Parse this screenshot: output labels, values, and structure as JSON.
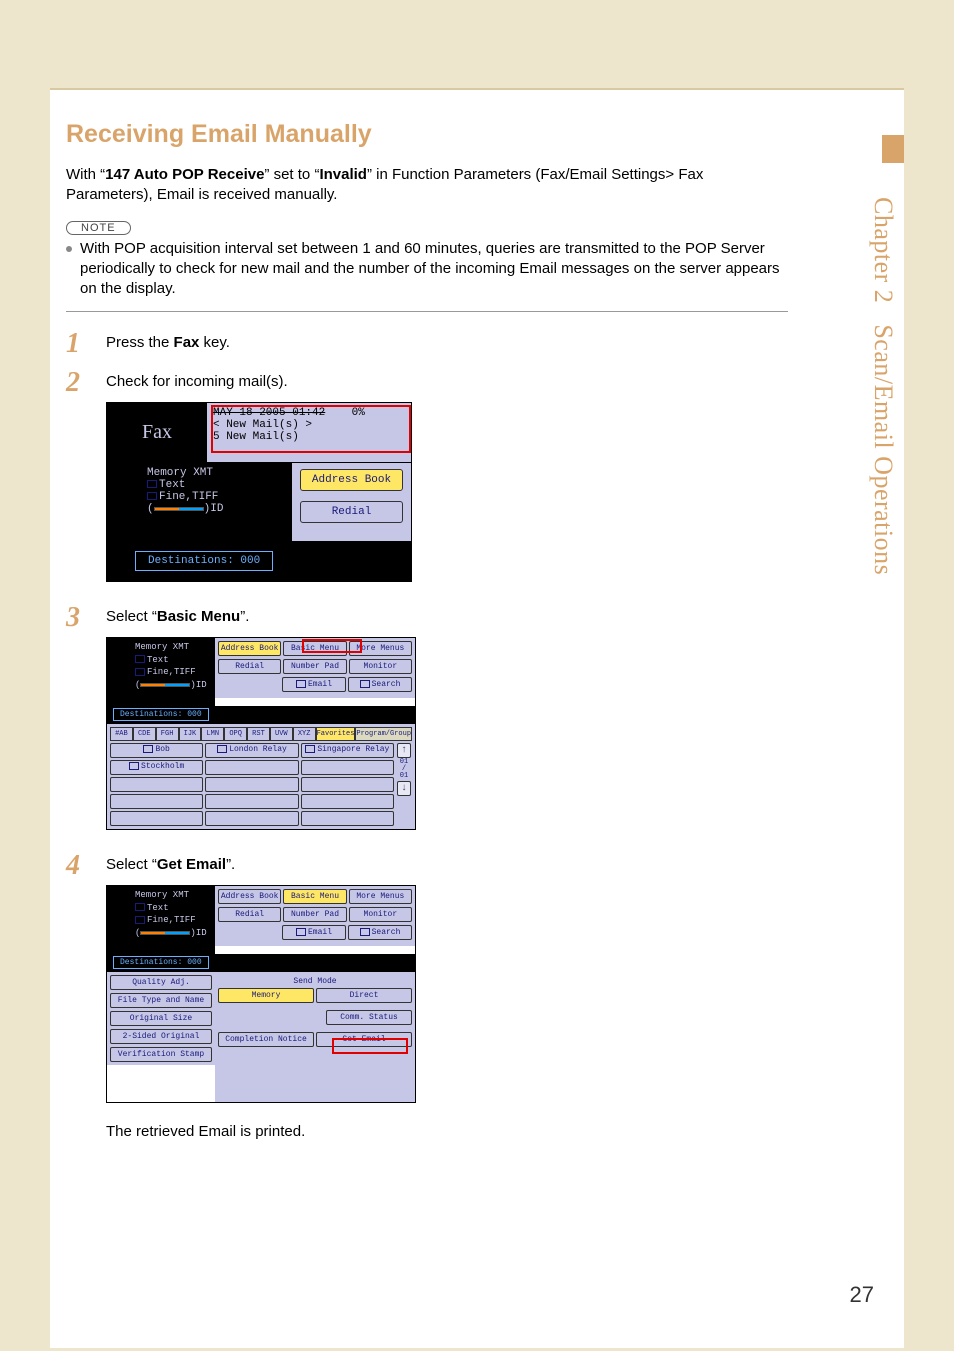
{
  "side_chapter": "Chapter 2",
  "side_section": "Scan/Email Operations",
  "heading": "Receiving Email Manually",
  "intro_pre": "With “",
  "intro_bold1": "147 Auto POP Receive",
  "intro_mid1": "” set to “",
  "intro_bold2": "Invalid",
  "intro_post": "” in Function Parameters (Fax/Email Settings> Fax Parameters), Email is received manually.",
  "note_label": "NOTE",
  "note_text": "With POP acquisition interval set between 1 and 60 minutes, queries are transmitted to the POP Server periodically to check for new mail and the number of the incoming Email messages on the server appears on the display.",
  "steps": {
    "s1_num": "1",
    "s1_pre": "Press the ",
    "s1_bold": "Fax",
    "s1_post": " key.",
    "s2_num": "2",
    "s2_text": "Check for incoming mail(s).",
    "s3_num": "3",
    "s3_pre": "Select “",
    "s3_bold": "Basic Menu",
    "s3_post": "”.",
    "s4_num": "4",
    "s4_pre": "Select “",
    "s4_bold": "Get Email",
    "s4_post": "”.",
    "s4_tail": "The retrieved Email is printed."
  },
  "fig1": {
    "fax": "Fax",
    "date": "MAY 18 2005  01:42",
    "pct": "0%",
    "newmail1": "< New Mail(s) >",
    "newmail2": "5 New Mail(s)",
    "memory_xmt": "Memory XMT",
    "text": "Text",
    "fine": "Fine,TIFF",
    "id": "ID",
    "addr": "Address Book",
    "redial": "Redial",
    "dest": "Destinations: 000"
  },
  "fig2": {
    "memory_xmt": "Memory XMT",
    "text": "Text",
    "fine": "Fine,TIFF",
    "id": "ID",
    "dest": "Destinations: 000",
    "top": {
      "addr": "Address Book",
      "basic": "Basic Menu",
      "more": "More Menus"
    },
    "row2": {
      "redial": "Redial",
      "numpad": "Number Pad",
      "monitor": "Monitor"
    },
    "row3": {
      "email": "Email",
      "search": "Search"
    },
    "tabs": [
      "#AB",
      "CDE",
      "FGH",
      "IJK",
      "LMN",
      "OPQ",
      "RST",
      "UVW",
      "XYZ",
      "Favorites",
      "Program/Group"
    ],
    "contacts": {
      "c1": "Bob",
      "c2": "London Relay",
      "c3": "Singapore Relay",
      "c4": "Stockholm"
    },
    "scroll": {
      "up": "↑",
      "ind": "01\n/\n01",
      "down": "↓"
    }
  },
  "fig3": {
    "memory_xmt": "Memory XMT",
    "text": "Text",
    "fine": "Fine,TIFF",
    "id": "ID",
    "dest": "Destinations: 000",
    "top": {
      "addr": "Address Book",
      "basic": "Basic Menu",
      "more": "More Menus"
    },
    "row2": {
      "redial": "Redial",
      "numpad": "Number Pad",
      "monitor": "Monitor"
    },
    "row3": {
      "email": "Email",
      "search": "Search"
    },
    "sendmode": "Send Mode",
    "memory": "Memory",
    "direct": "Direct",
    "comm": "Comm. Status",
    "completion": "Completion Notice",
    "getemail": "Get Email",
    "left": [
      "Quality Adj.",
      "File Type and Name",
      "Original Size",
      "2-Sided Original",
      "Verification Stamp"
    ]
  },
  "page_number": "27"
}
